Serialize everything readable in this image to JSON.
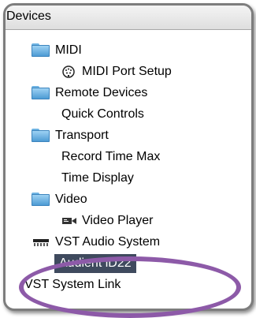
{
  "panel": {
    "header": "Devices",
    "items": [
      {
        "label": "MIDI",
        "icon": "folder-icon",
        "type": "folder"
      },
      {
        "label": "MIDI Port Setup",
        "icon": "midi-port-icon",
        "type": "device"
      },
      {
        "label": "Remote Devices",
        "icon": "folder-icon",
        "type": "folder"
      },
      {
        "label": "Quick Controls",
        "icon": "",
        "type": "device"
      },
      {
        "label": "Transport",
        "icon": "folder-icon",
        "type": "folder"
      },
      {
        "label": "Record Time Max",
        "icon": "",
        "type": "device"
      },
      {
        "label": "Time Display",
        "icon": "",
        "type": "device"
      },
      {
        "label": "Video",
        "icon": "folder-icon",
        "type": "folder"
      },
      {
        "label": "Video Player",
        "icon": "video-player-icon",
        "type": "device"
      },
      {
        "label": "VST Audio System",
        "icon": "vst-audio-icon",
        "type": "device"
      },
      {
        "label": "Audient iD22",
        "icon": "",
        "type": "device",
        "selected": true
      },
      {
        "label": "VST System Link",
        "icon": "",
        "type": "device"
      }
    ]
  },
  "colors": {
    "selection": "#3f4a5e",
    "highlight_ring": "#8d5aa8",
    "folder": "#5aa7dc",
    "border": "#7d7d7d"
  }
}
